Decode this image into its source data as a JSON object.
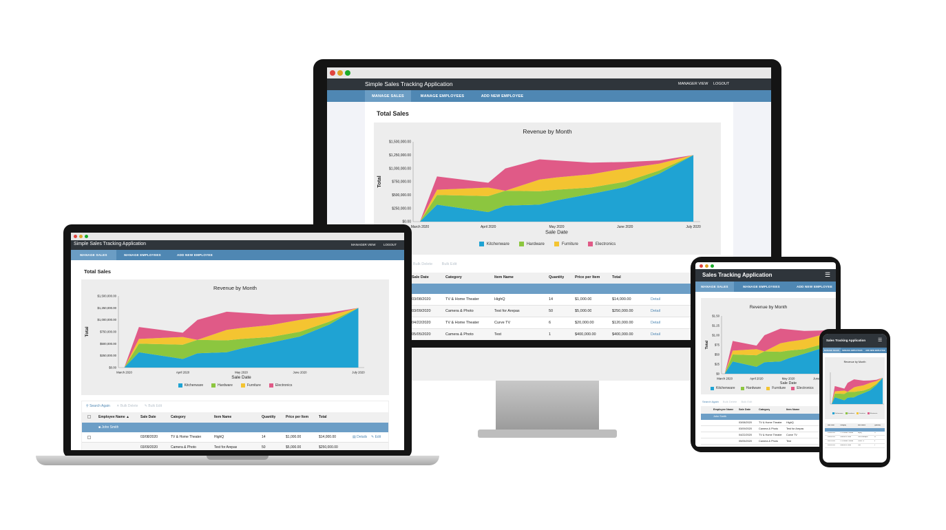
{
  "app": {
    "title": "Simple Sales Tracking Application",
    "title_short": "Sales Tracking Application",
    "manager_view": "MANAGER VIEW",
    "logout": "LOGOUT",
    "nav": [
      "MANAGE SALES",
      "MANAGE EMPLOYEES",
      "ADD NEW EMPLOYEE"
    ],
    "section_title": "Total Sales",
    "toolbar": {
      "search_again": "Search Again",
      "bulk_delete": "Bulk Delete",
      "bulk_edit": "Bulk Edit"
    },
    "columns": [
      "Employee Name",
      "Sale Date",
      "Category",
      "Item Name",
      "Quantity",
      "Price per Item",
      "Total"
    ],
    "group_label": "John Smith",
    "row_actions": {
      "details": "Details",
      "edit": "Edit"
    },
    "rows": [
      {
        "date": "03/08/2020",
        "category": "TV & Home Theater",
        "item": "HighQ",
        "qty": "14",
        "price": "$1,000.00",
        "total": "$14,000.00"
      },
      {
        "date": "03/09/2020",
        "category": "Camera & Photo",
        "item": "Test for Arepas",
        "qty": "50",
        "price": "$5,000.00",
        "total": "$250,000.00"
      },
      {
        "date": "04/22/2020",
        "category": "TV & Home Theater",
        "item": "Curve TV",
        "qty": "6",
        "price": "$20,000.00",
        "total": "$120,000.00"
      },
      {
        "date": "05/05/2020",
        "category": "Camera & Photo",
        "item": "Test",
        "qty": "1",
        "price": "$400,000.00",
        "total": "$400,000.00"
      }
    ],
    "colors": {
      "titlebar": "#2f353b",
      "nav": "#4f87b3",
      "nav_active": "#6b9dc4",
      "group": "#6c9ec6"
    }
  },
  "chart_data": {
    "type": "area",
    "title": "Revenue by Month",
    "xlabel": "Sale Date",
    "ylabel": "Total",
    "categories": [
      "March 2020",
      "April 2020",
      "May 2020",
      "June 2020",
      "July 2020"
    ],
    "x_ticks": [
      "March 2020",
      "April 2020",
      "May 2020",
      "June 2020",
      "July 2020"
    ],
    "y_ticks": [
      "$0.00",
      "$250,000.00",
      "$500,000.00",
      "$750,000.00",
      "$1,000,000.00",
      "$1,250,000.00",
      "$1,500,000.00"
    ],
    "y_ticks_phone": [
      "$0",
      "$25",
      "$50",
      "$75",
      "$1.00",
      "$1.25",
      "$1.50"
    ],
    "ylim": [
      0,
      1500000
    ],
    "stacked": true,
    "x_positions": [
      0,
      0.25,
      0.5,
      0.75,
      1,
      1.5,
      2,
      2.5,
      3,
      3.5,
      4
    ],
    "series": [
      {
        "name": "Kitchenware",
        "color": "#1fa3d3",
        "values": [
          0,
          320000,
          180000,
          300000,
          320000,
          400000,
          520000,
          650000,
          900000,
          1250000
        ]
      },
      {
        "name": "Hardware",
        "color": "#8cc63f",
        "values": [
          0,
          180000,
          300000,
          280000,
          250000,
          200000,
          120000,
          100000,
          60000,
          0
        ]
      },
      {
        "name": "Furniture",
        "color": "#f4c431",
        "values": [
          0,
          100000,
          160000,
          0,
          220000,
          230000,
          250000,
          250000,
          130000,
          0
        ]
      },
      {
        "name": "Electronics",
        "color": "#e05a87",
        "values": [
          0,
          250000,
          90000,
          420000,
          380000,
          320000,
          220000,
          120000,
          60000,
          0
        ]
      }
    ],
    "x_idx": [
      0,
      0.25,
      1.0,
      1.25,
      1.75,
      2.0,
      2.5,
      3.0,
      3.5,
      4.0
    ],
    "legend_position": "bottom"
  }
}
